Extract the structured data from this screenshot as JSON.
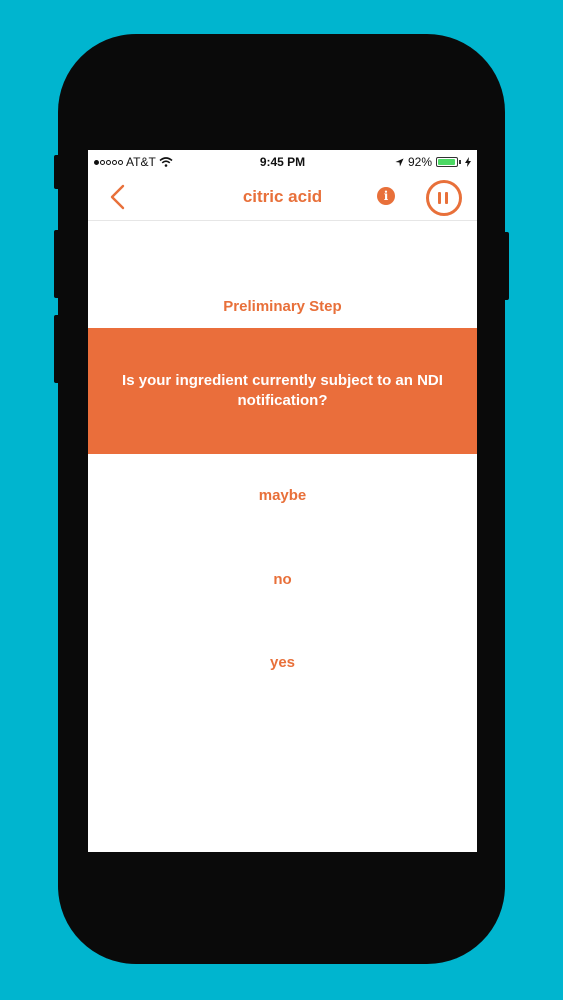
{
  "status_bar": {
    "carrier": "AT&T",
    "time": "9:45 PM",
    "battery_percent": "92%",
    "signal_bars_filled": 1,
    "signal_bars_total": 5
  },
  "navbar": {
    "title": "citric acid",
    "back_icon": "chevron-left-icon",
    "info_icon_glyph": "i",
    "pause_icon": "pause-circle-icon"
  },
  "content": {
    "step_label": "Preliminary Step",
    "question": "Is your ingredient currently subject to an NDI notification?",
    "answers": [
      "maybe",
      "no",
      "yes"
    ]
  },
  "colors": {
    "accent": "#e8703a",
    "question_band": "#ea6e3b",
    "background": "#00b5cf"
  }
}
